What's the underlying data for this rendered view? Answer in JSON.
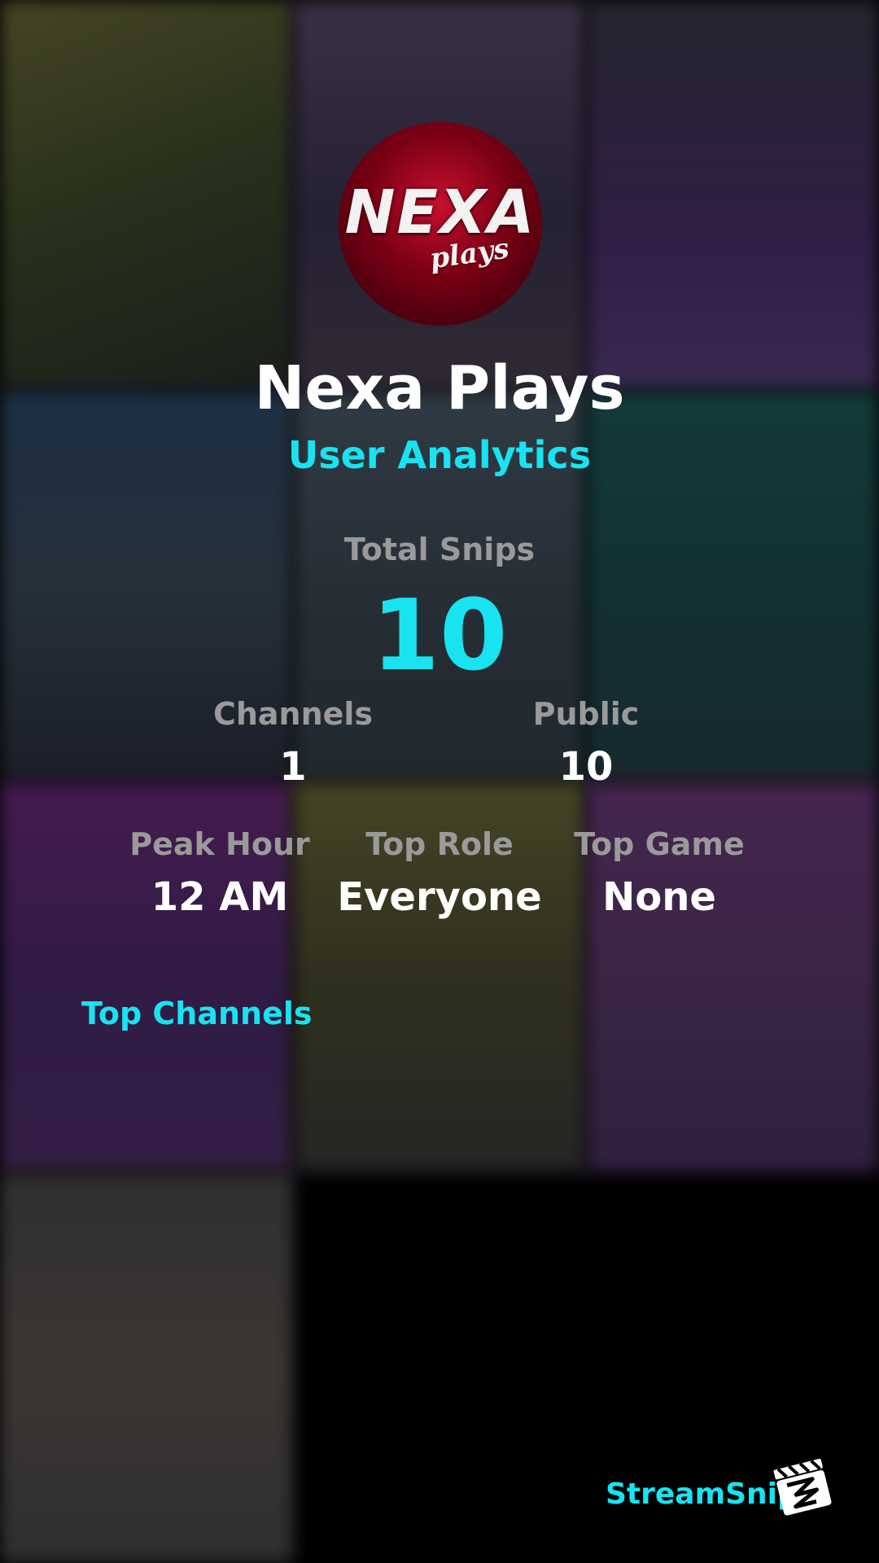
{
  "profile": {
    "name": "Nexa Plays",
    "subtitle": "User Analytics",
    "logo_text": "NEXA",
    "logo_subtext": "plays"
  },
  "stats": {
    "total_snips_label": "Total Snips",
    "total_snips_value": "10",
    "channels_label": "Channels",
    "channels_value": "1",
    "public_label": "Public",
    "public_value": "10",
    "peak_hour_label": "Peak Hour",
    "peak_hour_value": "12 AM",
    "top_role_label": "Top Role",
    "top_role_value": "Everyone",
    "top_game_label": "Top Game",
    "top_game_value": "None"
  },
  "sections": {
    "top_channels": "Top Channels"
  },
  "brand": {
    "name": "StreamSnip",
    "icon": "clapperboard-icon"
  },
  "colors": {
    "accent": "#19e3f0",
    "label": "#9a9a9a",
    "value": "#ffffff",
    "background": "#000000"
  }
}
